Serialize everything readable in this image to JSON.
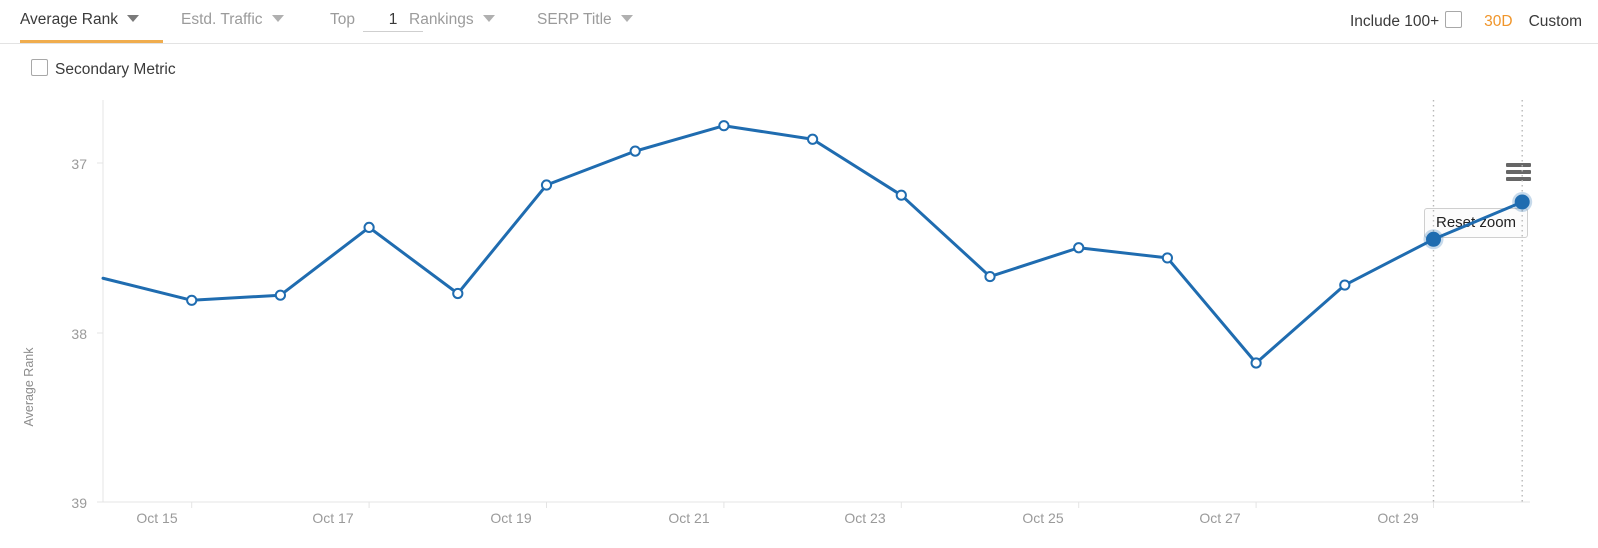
{
  "toolbar": {
    "tabs": [
      {
        "label": "Average Rank",
        "active": true,
        "x": 20,
        "caret": "chevron-down-icon"
      },
      {
        "label": "Estd. Traffic",
        "active": false,
        "x": 181,
        "caret": "chevron-down-icon"
      },
      {
        "label": "Rankings",
        "active": false,
        "x": 409,
        "caret": "chevron-down-icon"
      },
      {
        "label": "SERP Title",
        "active": false,
        "x": 537,
        "caret": "chevron-down-icon"
      }
    ],
    "top_label": "Top",
    "top_value": "1",
    "top_placeholder": "1",
    "include_100_label": "Include 100+",
    "include_100_checked": false,
    "range_30d": "30D",
    "range_custom": "Custom",
    "active_underline_color": "#f0ad4e",
    "accent_color": "#f0952a"
  },
  "secondary_metric": {
    "label": "Secondary Metric",
    "checked": false
  },
  "chart_controls": {
    "menu_icon": "hamburger-menu-icon",
    "reset_zoom_label": "Reset zoom"
  },
  "chart_data": {
    "type": "line",
    "title": "",
    "xlabel": "",
    "ylabel": "Average Rank",
    "ylim": [
      39,
      37
    ],
    "y_inverted": true,
    "yticks": [
      37,
      38,
      39
    ],
    "ytick_labels": [
      "37",
      "38",
      "39"
    ],
    "xticks": [
      "Oct 15",
      "Oct 17",
      "Oct 19",
      "Oct 21",
      "Oct 23",
      "Oct 25",
      "Oct 27",
      "Oct 29"
    ],
    "grid": false,
    "legend": "none",
    "line_color": "#1f6cb0",
    "marker_fill": "#ffffff",
    "highlight_fill": "#1f6cb0",
    "x": [
      "Oct 14",
      "Oct 15",
      "Oct 16",
      "Oct 17",
      "Oct 18",
      "Oct 19",
      "Oct 20",
      "Oct 21",
      "Oct 22",
      "Oct 23",
      "Oct 24",
      "Oct 25",
      "Oct 26",
      "Oct 27",
      "Oct 28",
      "Oct 29",
      "Oct 30"
    ],
    "values": [
      37.68,
      37.81,
      37.78,
      37.38,
      37.77,
      37.13,
      36.93,
      36.78,
      36.86,
      37.19,
      37.67,
      37.5,
      37.56,
      38.18,
      37.72,
      37.45,
      37.23
    ],
    "highlighted_indices": [
      15,
      16
    ],
    "plotlines": [
      "Oct 29",
      "Oct 30"
    ],
    "series": [
      {
        "name": "Average Rank",
        "values": [
          37.68,
          37.81,
          37.78,
          37.38,
          37.77,
          37.13,
          36.93,
          36.78,
          36.86,
          37.19,
          37.67,
          37.5,
          37.56,
          38.18,
          37.72,
          37.45,
          37.23
        ]
      }
    ]
  }
}
